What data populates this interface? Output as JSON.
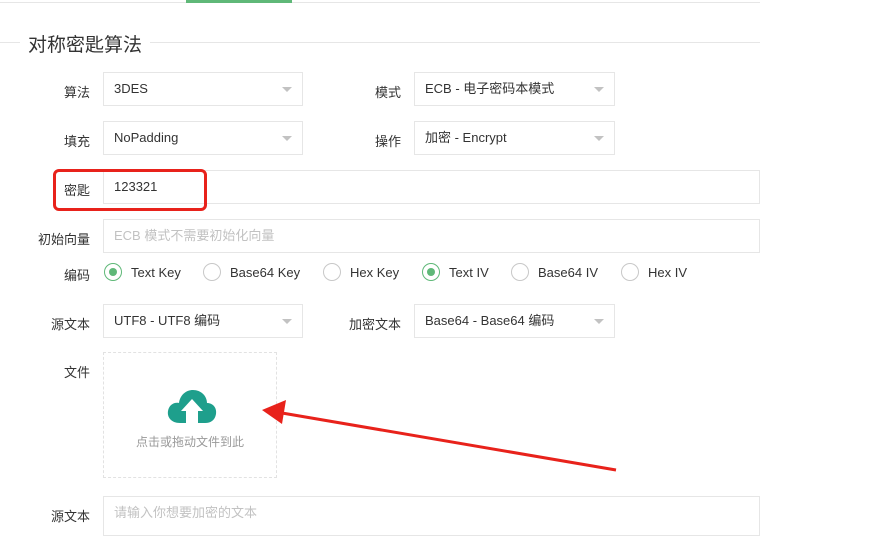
{
  "section": {
    "title": "对称密匙算法"
  },
  "fields": {
    "algorithm": {
      "label": "算法",
      "value": "3DES"
    },
    "mode": {
      "label": "模式",
      "value": "ECB - 电子密码本模式"
    },
    "padding": {
      "label": "填充",
      "value": "NoPadding"
    },
    "operation": {
      "label": "操作",
      "value": "加密 - Encrypt"
    },
    "key": {
      "label": "密匙",
      "value": "123321"
    },
    "iv": {
      "label": "初始向量",
      "placeholder": "ECB 模式不需要初始化向量"
    },
    "encoding": {
      "label": "编码",
      "options": [
        {
          "label": "Text Key",
          "checked": true
        },
        {
          "label": "Base64 Key",
          "checked": false
        },
        {
          "label": "Hex Key",
          "checked": false
        },
        {
          "label": "Text IV",
          "checked": true
        },
        {
          "label": "Base64 IV",
          "checked": false
        },
        {
          "label": "Hex IV",
          "checked": false
        }
      ]
    },
    "source_text_encoding": {
      "label": "源文本",
      "value": "UTF8 - UTF8 编码"
    },
    "encrypted_text_encoding": {
      "label": "加密文本",
      "value": "Base64 - Base64 编码"
    },
    "file": {
      "label": "文件",
      "hint": "点击或拖动文件到此"
    },
    "source_text": {
      "label": "源文本",
      "placeholder": "请输入你想要加密的文本"
    }
  },
  "colors": {
    "accent": "#5fb878",
    "annotation": "#e8221b"
  }
}
